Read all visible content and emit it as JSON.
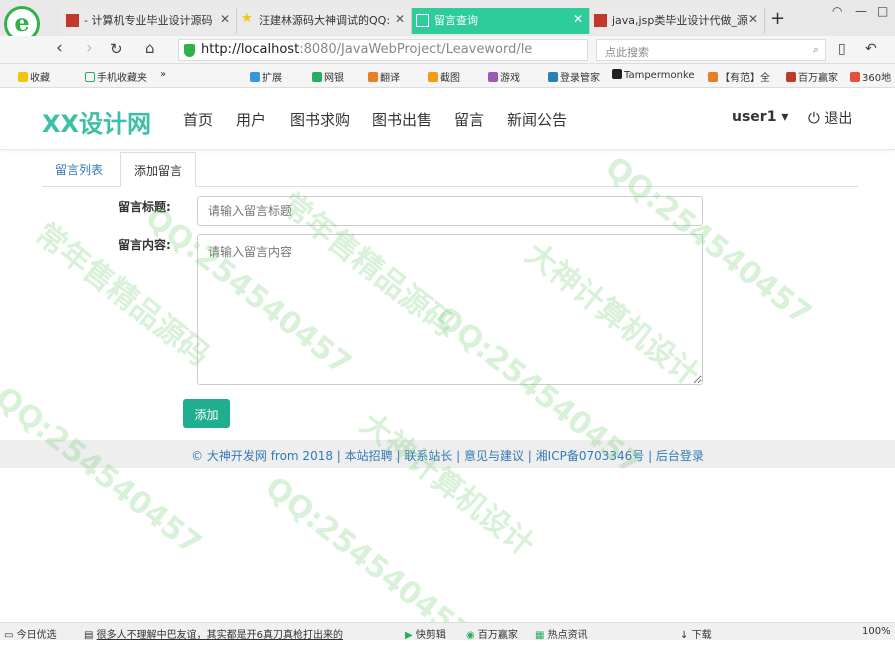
{
  "browser": {
    "tabs": [
      {
        "label": "- 计算机专业毕业设计源码",
        "favicon_color": "#c0392b"
      },
      {
        "label": "汪建林源码大神调试的QQ:",
        "favicon_color": "#f1c40f"
      },
      {
        "label": "留言查询",
        "favicon_color": "#ffffff"
      },
      {
        "label": "java,jsp类毕业设计代做_源",
        "favicon_color": "#c0392b"
      }
    ],
    "active_tab_index": 2,
    "new_tab_label": "+",
    "address_host": "http://localhost",
    "address_rest": ":8080/JavaWebProject/Leaveword/le",
    "search_placeholder": "点此搜索",
    "bookmarks": [
      "收藏",
      "手机收藏夹",
      "»",
      "扩展",
      "网银",
      "翻译",
      "截图",
      "游戏",
      "登录管家",
      "Tampermonke",
      "【有范】全",
      "百万赢家",
      "360地"
    ]
  },
  "site": {
    "logo": "XX设计网",
    "nav": [
      "首页",
      "用户",
      "图书求购",
      "图书出售",
      "留言",
      "新闻公告"
    ],
    "user": "user1 ▾",
    "logout": "退出"
  },
  "tabs": [
    "留言列表",
    "添加留言"
  ],
  "form": {
    "title_label": "留言标题:",
    "title_placeholder": "请输入留言标题",
    "content_label": "留言内容:",
    "content_placeholder": "请输入留言内容",
    "submit_label": "添加"
  },
  "footer": {
    "text": "© 大神开发网 from 2018 | 本站招聘 | 联系站长 | 意见与建议 | 湘ICP备0703346号 | 后台登录"
  },
  "watermarks": [
    "常年售精品源码",
    "QQ:254540457",
    "大神计算机设计"
  ],
  "statusbar": [
    "今日优选",
    "很多人不理解中巴友谊，其实都是开6真刀真枪打出来的",
    "快剪辑",
    "百万赢家",
    "热点资讯",
    "下载",
    "100%"
  ],
  "colors": {
    "accent": "#1fae8f",
    "logo": "#3cbfa6",
    "link": "#337ab7",
    "active_tab": "#2ecc9a"
  }
}
